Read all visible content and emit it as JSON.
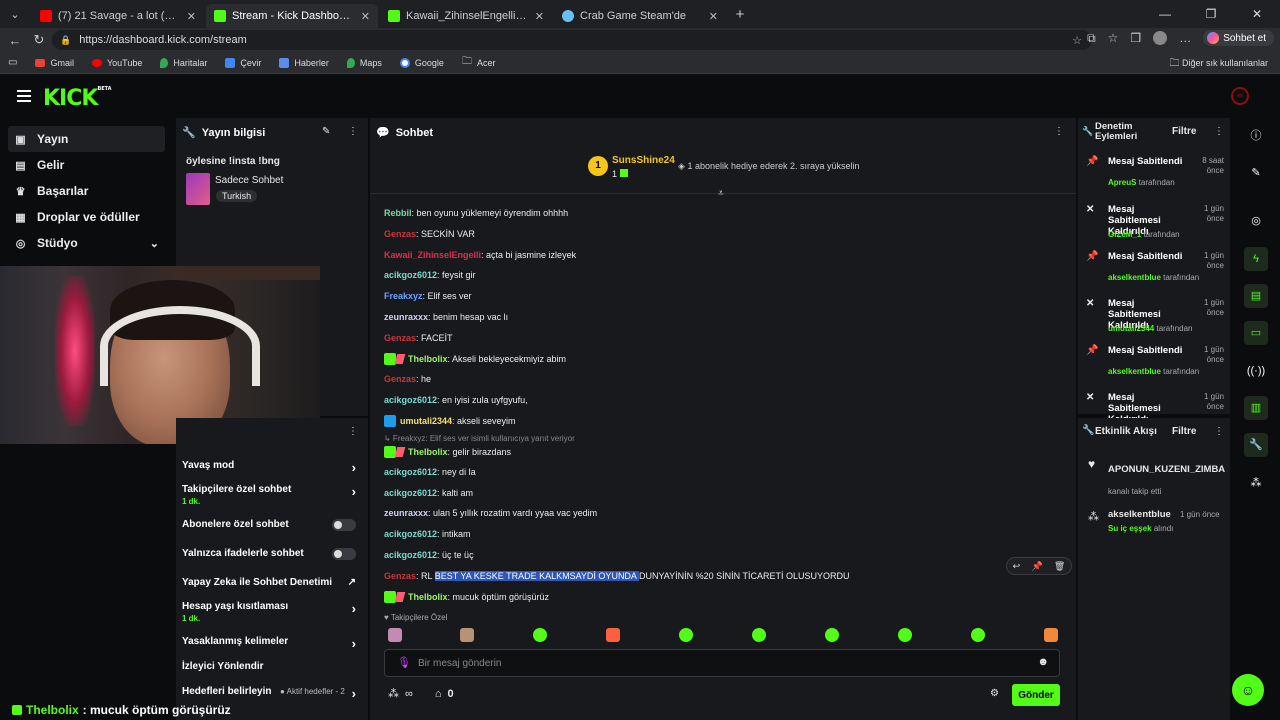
{
  "browser": {
    "tabs": [
      {
        "label": "(7) 21 Savage - a lot (Official Video)",
        "color": "#ff0000"
      },
      {
        "label": "Stream - Kick Dashboard",
        "color": "#53fc18"
      },
      {
        "label": "Kawaii_ZihinselEngelli Stream - We",
        "color": "#53fc18"
      },
      {
        "label": "Crab Game Steam'de",
        "color": "#1b2838"
      }
    ],
    "url": "https://dashboard.kick.com/stream",
    "sohbet_label": "Sohbet et",
    "bookmarks": [
      "Gmail",
      "YouTube",
      "Haritalar",
      "Çevir",
      "Haberler",
      "Maps",
      "Google",
      "Acer"
    ],
    "other_bookmarks": "Diğer sık kullanılanlar"
  },
  "brand": {
    "logo": "KICK",
    "beta": "BETA",
    "accent": "#53fc18"
  },
  "nav": {
    "items": [
      "Yayın",
      "Gelir",
      "Başarılar",
      "Droplar ve ödüller",
      "Stüdyo"
    ]
  },
  "stream_info": {
    "header": "Yayın bilgisi",
    "title": "öylesine !insta !bng",
    "category": "Sadece Sohbet",
    "language": "Turkish"
  },
  "chat_settings": {
    "items": [
      {
        "label": "Yavaş mod",
        "sub": "",
        "control": "arrow"
      },
      {
        "label": "Takipçilere özel sohbet",
        "sub": "1 dk.",
        "control": "arrow"
      },
      {
        "label": "Abonelere özel sohbet",
        "sub": "",
        "control": "toggle"
      },
      {
        "label": "Yalnızca ifadelerle sohbet",
        "sub": "",
        "control": "toggle"
      },
      {
        "label": "Yapay Zeka ile Sohbet Denetimi",
        "sub": "",
        "control": "external"
      },
      {
        "label": "Hesap yaşı kısıtlaması",
        "sub": "1 dk.",
        "control": "arrow"
      },
      {
        "label": "Yasaklanmış kelimeler",
        "sub": "",
        "control": "arrow"
      },
      {
        "label": "İzleyici Yönlendir",
        "sub": "",
        "control": "none"
      },
      {
        "label": "Hedefleri belirleyin",
        "sub": "",
        "control": "arrow"
      }
    ],
    "goals_badge": "Aktif hedefler - 2"
  },
  "chat": {
    "header": "Sohbet",
    "pinned_user": "SunsShine24",
    "pinned_rank": "1",
    "pinned_count": "1",
    "pinned_text": "1 abonelik hediye ederek 2. sıraya yükselin",
    "reply_note": "Freakxyz: Elif ses ver isimli kullanıcıya yanıt veriyor",
    "messages": [
      {
        "user": "Rebbil",
        "color": "#7bd9a8",
        "text": "ben oyunu yüklemeyi öyrendim ohhhh",
        "badge": ""
      },
      {
        "user": "Genzas",
        "color": "#c8363a",
        "text": "SECKİN VAR",
        "badge": ""
      },
      {
        "user": "Kawaii_ZihinselEngelli",
        "color": "#d9314a",
        "text": "açta bi jasmine izleyek",
        "badge": ""
      },
      {
        "user": "acikgoz6012",
        "color": "#7bd9d1",
        "text": "feysit gir",
        "badge": ""
      },
      {
        "user": "Freakxyz",
        "color": "#6ea2ff",
        "text": "Elif ses ver",
        "badge": ""
      },
      {
        "user": "zeunraxxx",
        "color": "#cfd2f5",
        "text": "benim hesap vac lı",
        "badge": ""
      },
      {
        "user": "Genzas",
        "color": "#c8363a",
        "text": "FACEİT",
        "badge": ""
      },
      {
        "user": "Thelbolix",
        "color": "#9cf56b",
        "text": "Akseli bekleyecekmiyiz abim",
        "badge": "mod"
      },
      {
        "user": "Genzas",
        "color": "#c8363a",
        "text": "he",
        "badge": ""
      },
      {
        "user": "acikgoz6012",
        "color": "#7bd9d1",
        "text": "en iyisi zula uyfgyufu,",
        "badge": ""
      },
      {
        "user": "umutali2344",
        "color": "#f2e36b",
        "text": "akseli seveyim",
        "badge": "blue"
      },
      {
        "user": "Thelbolix",
        "color": "#9cf56b",
        "text": "gelir birazdans",
        "badge": "mod"
      },
      {
        "user": "acikgoz6012",
        "color": "#7bd9d1",
        "text": "ney di la",
        "badge": ""
      },
      {
        "user": "acikgoz6012",
        "color": "#7bd9d1",
        "text": "kalti am",
        "badge": ""
      },
      {
        "user": "zeunraxxx",
        "color": "#cfd2f5",
        "text": "ulan 5 yıllık rozatim vardı yyaa vac yedim",
        "badge": ""
      },
      {
        "user": "acikgoz6012",
        "color": "#7bd9d1",
        "text": "intikam",
        "badge": ""
      },
      {
        "user": "acikgoz6012",
        "color": "#7bd9d1",
        "text": "üç te üç",
        "badge": ""
      },
      {
        "user": "Genzas",
        "color": "#c8363a",
        "text": "RL BEST YA KESKE TRADE KALKMSAYDİ OYUNDA DUNYAYİNİN %20 SİNİN TİCARETİ OLUSUYORDU",
        "badge": ""
      },
      {
        "user": "Thelbolix",
        "color": "#9cf56b",
        "text": "mucuk öptüm görüşürüz",
        "badge": "mod"
      }
    ],
    "highlight": {
      "before": "RL ",
      "selected": "BEST YA KESKE TRADE KALKMSAYDİ OYUNDA ",
      "after": "DUNYAYİNİN %20 SİNİN TİCARETİ OLUSUYORDU"
    },
    "followers_only": "Takipçilere Özel",
    "input_placeholder": "Bir mesaj gönderin",
    "send_label": "Gönder",
    "points": "0",
    "infinity": "∞"
  },
  "moderation": {
    "header": "Denetim Eylemleri",
    "filter": "Filtre",
    "items": [
      {
        "title": "Mesaj Sabitlendi",
        "by": "AprеuS",
        "suffix": "tarafından",
        "time": "8 saat önce",
        "icon": "pin"
      },
      {
        "title": "Mesaj Sabitlemesi Kaldırıldı",
        "by": "GİZeM_1",
        "suffix": "tarafından",
        "time": "1 gün önce",
        "icon": "unpin"
      },
      {
        "title": "Mesaj Sabitlendi",
        "by": "akselkentblue",
        "suffix": "tarafından",
        "time": "1 gün önce",
        "icon": "pin"
      },
      {
        "title": "Mesaj Sabitlemesi Kaldırıldı",
        "by": "umutali2344",
        "suffix": "tarafından",
        "time": "1 gün önce",
        "icon": "unpin"
      },
      {
        "title": "Mesaj Sabitlendi",
        "by": "akselkentblue",
        "suffix": "tarafından",
        "time": "1 gün önce",
        "icon": "pin"
      },
      {
        "title": "Mesaj Sabitlemesi Kaldırıldı",
        "by": "",
        "suffix": "",
        "time": "1 gün önce",
        "icon": "unpin"
      }
    ]
  },
  "activity": {
    "header": "Etkinlik Akışı",
    "filter": "Filtre",
    "items": [
      {
        "user": "APONUN_KUZENI_ZIMBA",
        "text": "kanalı takip etti",
        "time": ""
      },
      {
        "user": "akselkentblue",
        "text": "Su iç eşşek",
        "suffix": "alındı",
        "time": "1 gün önce"
      }
    ]
  },
  "ticker": {
    "user": "Thelbolix",
    "text": ": mucuk öptüm görüşürüz"
  }
}
